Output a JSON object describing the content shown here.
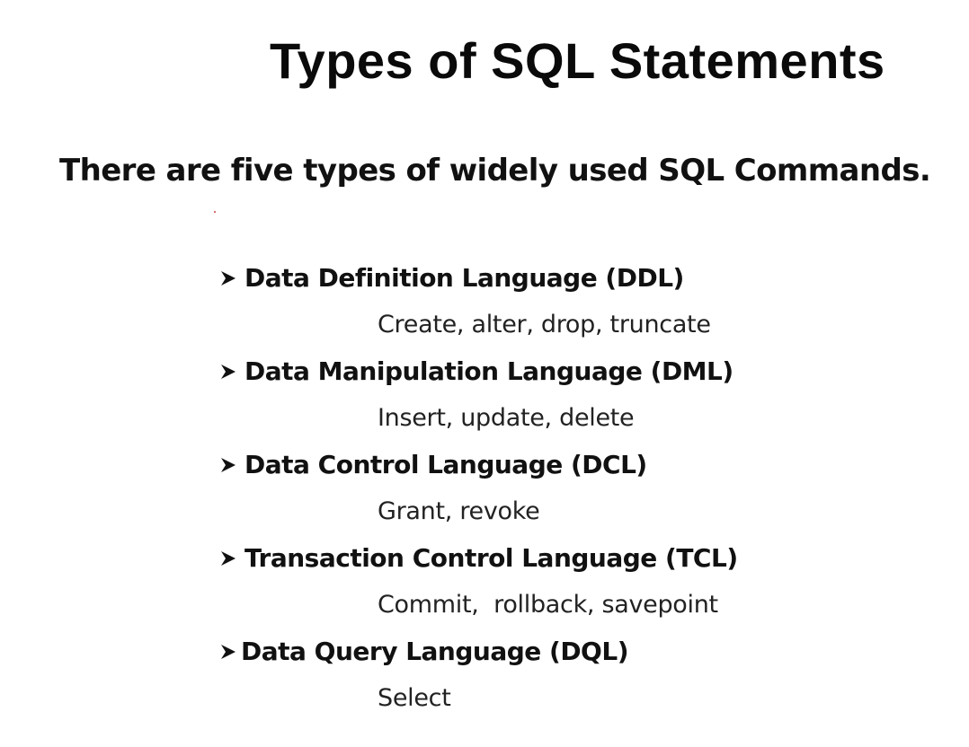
{
  "slide": {
    "title": "Types of SQL Statements",
    "subtitle": "There are five types of widely used SQL Commands.",
    "types": [
      {
        "name": "Data Definition Language (DDL)",
        "commands": "Create, alter, drop, truncate",
        "icon": "arrow-bullet-icon"
      },
      {
        "name": "Data Manipulation Language (DML)",
        "commands": "Insert, update, delete",
        "icon": "arrow-bullet-icon"
      },
      {
        "name": "Data Control Language (DCL)",
        "commands": "Grant, revoke",
        "icon": "arrow-bullet-icon"
      },
      {
        "name": "Transaction Control Language (TCL)",
        "commands": "Commit,  rollback, savepoint",
        "icon": "arrow-bullet-icon"
      },
      {
        "name": "Data Query Language (DQL)",
        "commands": "Select",
        "icon": "arrow-bullet-icon"
      }
    ]
  },
  "colors": {
    "background": "#ffffff",
    "text": "#111111"
  }
}
